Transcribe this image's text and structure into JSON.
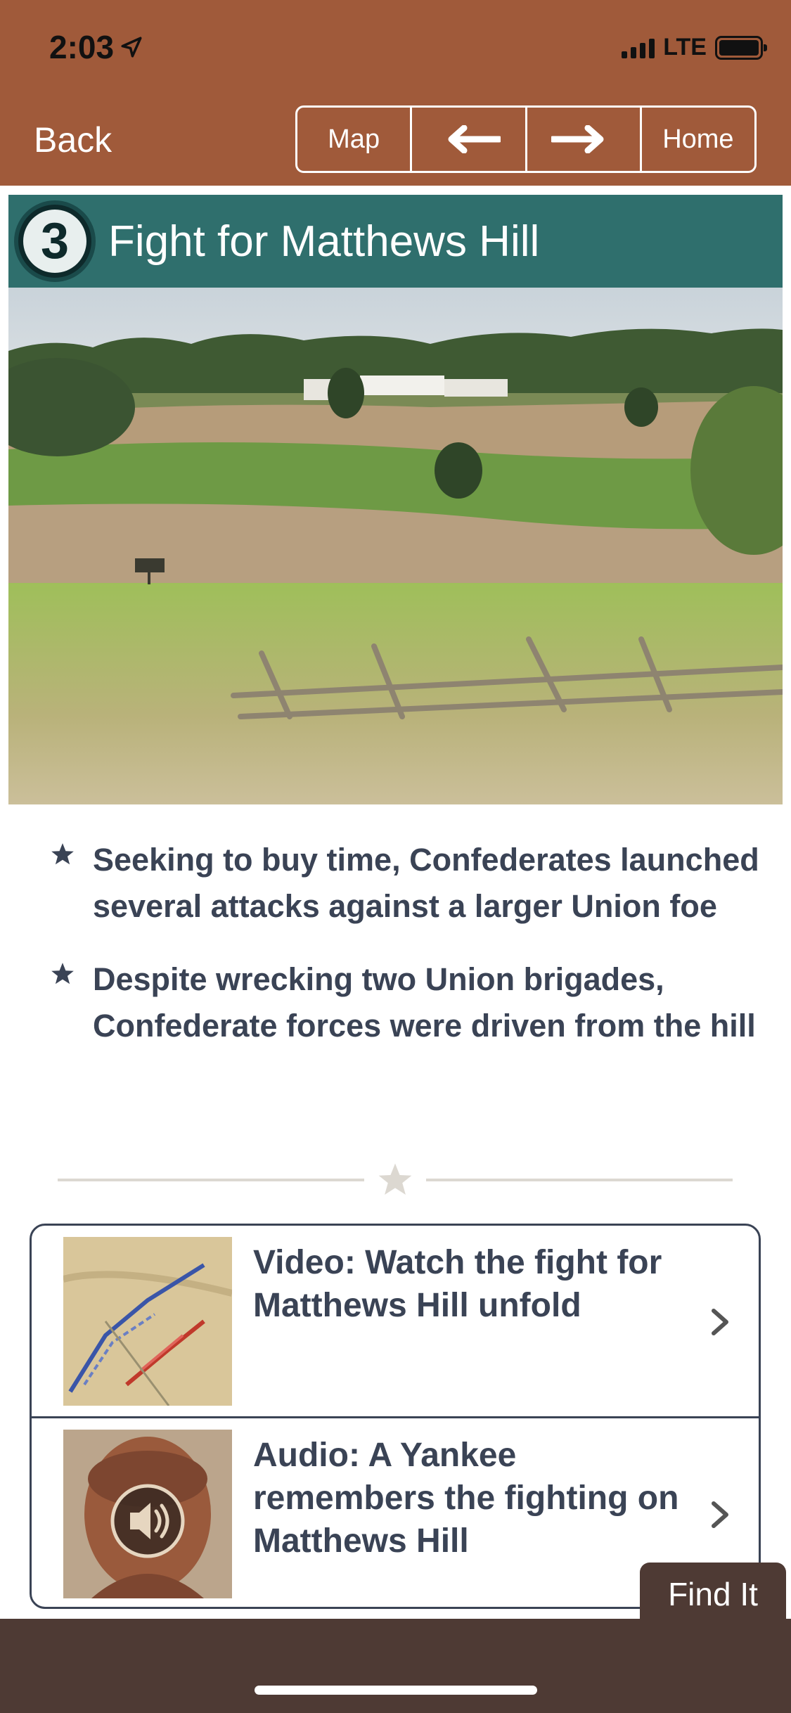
{
  "status_bar": {
    "time": "2:03",
    "network": "LTE"
  },
  "nav": {
    "back_label": "Back",
    "map_label": "Map",
    "prev_icon": "arrow-left-icon",
    "next_icon": "arrow-right-icon",
    "home_label": "Home"
  },
  "banner": {
    "stop_number": "3",
    "title": "Fight for Matthews Hill"
  },
  "bullets": [
    "Seeking to buy time, Confederates launched several attacks against a larger Union foe",
    "Despite wrecking two Union brigades, Confederate forces were driven from the hill"
  ],
  "media": [
    {
      "label": "Video: Watch the fight for Matthews Hill unfold",
      "thumb": "battle-map-thumbnail"
    },
    {
      "label": "Audio: A Yankee remembers the fighting on Matthews Hill",
      "thumb": "soldier-portrait-speaker-thumbnail"
    }
  ],
  "find_it_label": "Find It",
  "colors": {
    "header": "#a05a3a",
    "banner": "#2f6f6d",
    "text": "#3a4355",
    "footer": "#4e3a34"
  }
}
